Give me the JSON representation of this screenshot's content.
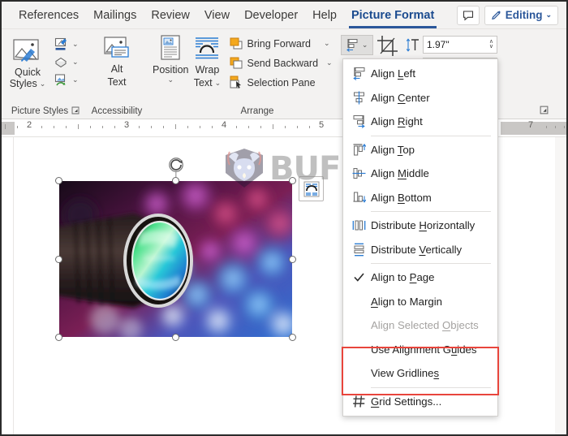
{
  "window": {
    "accent": "#2b579a",
    "highlight_box_color": "#e8453c"
  },
  "tabs": [
    {
      "label": "References",
      "active": false
    },
    {
      "label": "Mailings",
      "active": false
    },
    {
      "label": "Review",
      "active": false
    },
    {
      "label": "View",
      "active": false
    },
    {
      "label": "Developer",
      "active": false
    },
    {
      "label": "Help",
      "active": false
    },
    {
      "label": "Picture Format",
      "active": true
    }
  ],
  "tabstrip_right": {
    "comment_icon": "comment-icon",
    "editing_label": "Editing",
    "editing_caret": "⌄"
  },
  "ribbon": {
    "groups": [
      {
        "name": "Picture Styles",
        "label": "Picture Styles",
        "has_launcher": true
      },
      {
        "name": "Accessibility",
        "label": "Accessibility",
        "has_launcher": false
      },
      {
        "name": "Arrange",
        "label": "Arrange",
        "has_launcher": false
      },
      {
        "name": "Size",
        "label": "",
        "has_launcher": true
      }
    ],
    "picture_styles": {
      "quick_styles_line1": "Quick",
      "quick_styles_line2": "Styles",
      "quick_styles_caret": "⌄",
      "picture_border_caret": "⌄",
      "picture_effects_caret": "⌄",
      "picture_layout_caret": "⌄"
    },
    "accessibility": {
      "alt_text_line1": "Alt",
      "alt_text_line2": "Text"
    },
    "arrange": {
      "position_label": "Position",
      "position_caret": "⌄",
      "wrap_text_line1": "Wrap",
      "wrap_text_line2": "Text",
      "wrap_text_caret": "⌄",
      "bring_forward_label": "Bring Forward",
      "bring_forward_caret": "⌄",
      "send_backward_label": "Send Backward",
      "send_backward_caret": "⌄",
      "selection_pane_label": "Selection Pane",
      "align_caret": "⌄"
    },
    "size": {
      "crop_icon": "crop-icon",
      "height_icon": "shape-height-icon",
      "height_value": "1.97\"",
      "spin_up": "∧",
      "spin_down": "∨"
    }
  },
  "ruler": {
    "numbers": [
      "2",
      "3",
      "4",
      "5",
      "7"
    ]
  },
  "document": {
    "picture": {
      "alt": "camera-lens-photo",
      "rotate_handle": "rotate-handle"
    },
    "layout_options_button": "layout-options-button",
    "watermark_text": "BUFFCOM"
  },
  "align_menu": {
    "items": [
      {
        "id": "align-left",
        "label": "Align Left",
        "mnemonic": "L",
        "icon": "align-left-icon",
        "checked": false,
        "disabled": false,
        "sep_after": false
      },
      {
        "id": "align-center",
        "label": "Align Center",
        "mnemonic": "C",
        "icon": "align-center-icon",
        "checked": false,
        "disabled": false,
        "sep_after": false
      },
      {
        "id": "align-right",
        "label": "Align Right",
        "mnemonic": "R",
        "icon": "align-right-icon",
        "checked": false,
        "disabled": false,
        "sep_after": true
      },
      {
        "id": "align-top",
        "label": "Align Top",
        "mnemonic": "T",
        "icon": "align-top-icon",
        "checked": false,
        "disabled": false,
        "sep_after": false
      },
      {
        "id": "align-middle",
        "label": "Align Middle",
        "mnemonic": "M",
        "icon": "align-middle-icon",
        "checked": false,
        "disabled": false,
        "sep_after": false
      },
      {
        "id": "align-bottom",
        "label": "Align Bottom",
        "mnemonic": "B",
        "icon": "align-bottom-icon",
        "checked": false,
        "disabled": false,
        "sep_after": true
      },
      {
        "id": "distribute-horizontally",
        "label": "Distribute Horizontally",
        "mnemonic": "H",
        "icon": "distribute-horizontal-icon",
        "checked": false,
        "disabled": false,
        "sep_after": false
      },
      {
        "id": "distribute-vertically",
        "label": "Distribute Vertically",
        "mnemonic": "V",
        "icon": "distribute-vertical-icon",
        "checked": false,
        "disabled": false,
        "sep_after": true
      },
      {
        "id": "align-to-page",
        "label": "Align to Page",
        "mnemonic": "P",
        "icon": "checkmark-icon",
        "checked": true,
        "disabled": false,
        "sep_after": false
      },
      {
        "id": "align-to-margin",
        "label": "Align to Margin",
        "mnemonic": "A",
        "icon": "",
        "checked": false,
        "disabled": false,
        "sep_after": false
      },
      {
        "id": "align-selected-objects",
        "label": "Align Selected Objects",
        "mnemonic": "O",
        "icon": "",
        "checked": false,
        "disabled": true,
        "sep_after": false
      },
      {
        "id": "use-alignment-guides",
        "label": "Use Alignment Guides",
        "mnemonic": "u",
        "icon": "",
        "checked": false,
        "disabled": false,
        "sep_after": false
      },
      {
        "id": "view-gridlines",
        "label": "View Gridlines",
        "mnemonic": "s",
        "icon": "",
        "checked": false,
        "disabled": false,
        "sep_after": true
      },
      {
        "id": "grid-settings",
        "label": "Grid Settings...",
        "mnemonic": "G",
        "icon": "grid-icon",
        "checked": false,
        "disabled": false,
        "sep_after": false
      }
    ],
    "highlighted_ids": [
      "use-alignment-guides",
      "view-gridlines"
    ]
  }
}
